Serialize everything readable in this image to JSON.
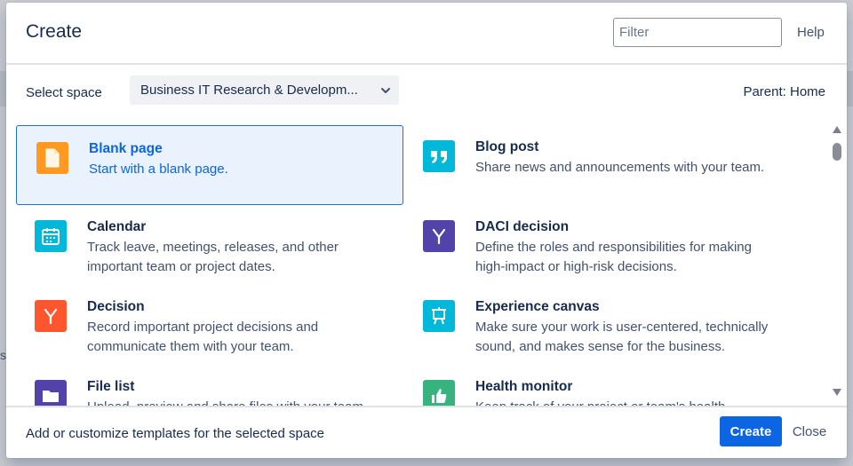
{
  "background": {
    "fragment": "s"
  },
  "dialog": {
    "title": "Create",
    "filter_placeholder": "Filter",
    "help_label": "Help"
  },
  "space": {
    "label": "Select space",
    "selected": "Business IT Research & Developm...",
    "parent": "Parent: Home"
  },
  "templates": [
    {
      "name": "Blank page",
      "description": "Start with a blank page.",
      "icon": "blank-page-icon",
      "color": "#ff991f",
      "selected": true
    },
    {
      "name": "Blog post",
      "description": "Share news and announcements with your team.",
      "icon": "quote-icon",
      "color": "#00b8d9"
    },
    {
      "name": "Calendar",
      "description": "Track leave, meetings, releases, and other important team or project dates.",
      "icon": "calendar-icon",
      "color": "#00b8d9"
    },
    {
      "name": "DACI decision",
      "description": "Define the roles and responsibilities for making high-impact or high-risk decisions.",
      "icon": "decision-branch-icon",
      "color": "#5243aa"
    },
    {
      "name": "Decision",
      "description": "Record important project decisions and communicate them with your team.",
      "icon": "decision-branch-icon",
      "color": "#ff5630"
    },
    {
      "name": "Experience canvas",
      "description": "Make sure your work is user-centered, technically sound, and makes sense for the business.",
      "icon": "canvas-easel-icon",
      "color": "#00b8d9"
    },
    {
      "name": "File list",
      "description": "Upload, preview and share files with your team.",
      "icon": "folder-icon",
      "color": "#5243aa"
    },
    {
      "name": "Health monitor",
      "description": "Keep track of your project or team's health.",
      "icon": "thumbs-up-icon",
      "color": "#36b37e"
    }
  ],
  "footer": {
    "link": "Add or customize templates for the selected space",
    "create_label": "Create",
    "close_label": "Close"
  },
  "colors": {
    "accent": "#0c66e4",
    "selected_bg": "#e9f2fd"
  }
}
